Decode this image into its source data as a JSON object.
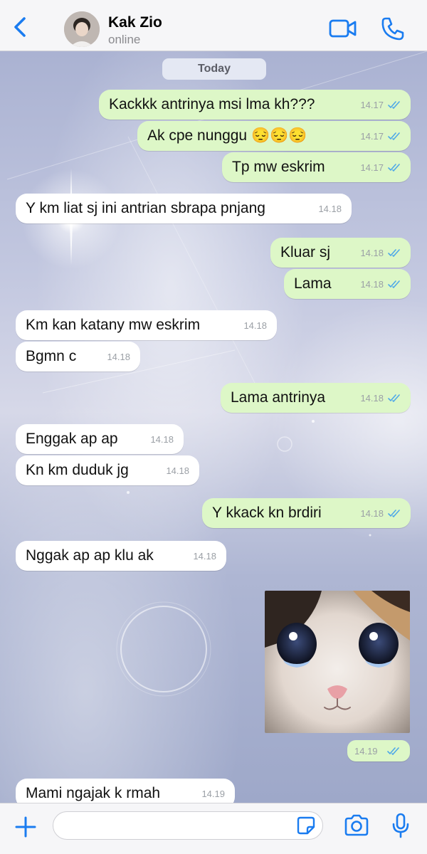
{
  "header": {
    "contact_name": "Kak Zio",
    "status": "online",
    "icons": {
      "back": "chevron-left-icon",
      "video": "video-camera-icon",
      "call": "phone-icon"
    }
  },
  "chat": {
    "date_label": "Today",
    "messages": [
      {
        "direction": "out",
        "text": "Kackkk antrinya msi lma kh???",
        "time": "14.17",
        "read": true
      },
      {
        "direction": "out",
        "text": "Ak cpe nunggu 😔😔😔",
        "time": "14.17",
        "read": true
      },
      {
        "direction": "out",
        "text": "Tp mw eskrim",
        "time": "14.17",
        "read": true
      },
      {
        "direction": "in",
        "text": "Y km liat sj ini antrian sbrapa pnjang",
        "time": "14.18"
      },
      {
        "direction": "out",
        "text": "Kluar sj",
        "time": "14.18",
        "read": true
      },
      {
        "direction": "out",
        "text": "Lama",
        "time": "14.18",
        "read": true
      },
      {
        "direction": "in",
        "text": "Km kan katany mw eskrim",
        "time": "14.18"
      },
      {
        "direction": "in",
        "text": "Bgmn c",
        "time": "14.18"
      },
      {
        "direction": "out",
        "text": "Lama antrinya",
        "time": "14.18",
        "read": true
      },
      {
        "direction": "in",
        "text": "Enggak ap ap",
        "time": "14.18"
      },
      {
        "direction": "in",
        "text": "Kn km duduk jg",
        "time": "14.18"
      },
      {
        "direction": "out",
        "text": "Y kkack kn brdiri",
        "time": "14.18",
        "read": true
      },
      {
        "direction": "in",
        "text": "Nggak ap ap klu ak",
        "time": "14.18"
      },
      {
        "direction": "out",
        "type": "image",
        "image": "crying-cat-sticker",
        "time": "14.19",
        "read": true
      },
      {
        "direction": "in",
        "text": "Mami ngajak k rmah",
        "time": "14.19"
      }
    ]
  },
  "input_bar": {
    "message_value": "",
    "icons": {
      "plus": "plus-icon",
      "sticker": "sticker-icon",
      "camera": "camera-icon",
      "mic": "microphone-icon"
    }
  },
  "colors": {
    "accent": "#1a7cf0",
    "outgoing_bubble": "#ddf7c7",
    "incoming_bubble": "#ffffff",
    "read_ticks": "#4fa8e8",
    "chat_background": "#b9c0db"
  }
}
